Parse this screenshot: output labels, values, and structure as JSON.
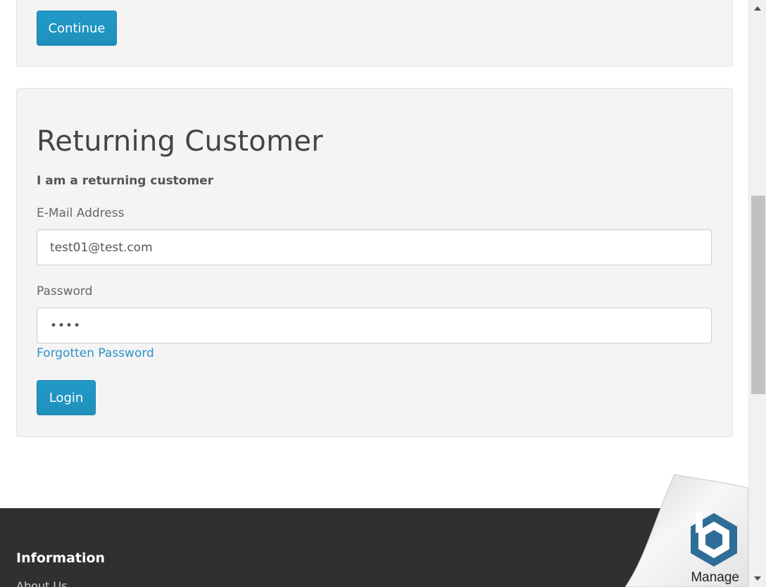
{
  "new_customer": {
    "continue_label": "Continue"
  },
  "returning_customer": {
    "title": "Returning Customer",
    "subtitle": "I am a returning customer",
    "email_label": "E-Mail Address",
    "email_value": "test01@test.com",
    "password_label": "Password",
    "password_value": "••••",
    "forgot_link": "Forgotten Password",
    "login_label": "Login"
  },
  "footer": {
    "heading": "Information",
    "link_1": "About Us"
  },
  "widget": {
    "label": "Manage",
    "icon": "hexagon-logo-icon"
  },
  "colors": {
    "button": "#229ac8",
    "link": "#2c93c6",
    "footer_bg": "#303030",
    "panel_bg": "#f4f4f4"
  }
}
